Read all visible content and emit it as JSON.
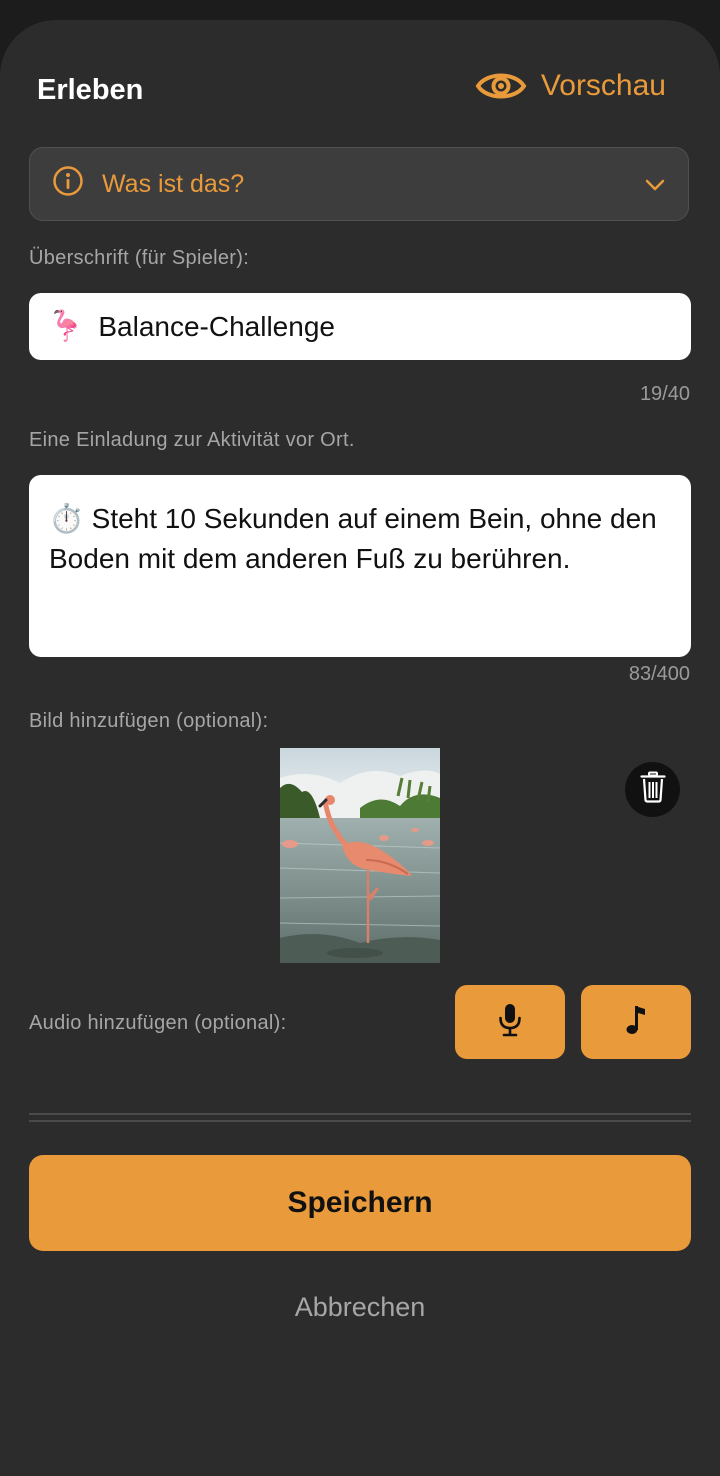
{
  "header": {
    "title": "Erleben",
    "preview_label": "Vorschau"
  },
  "info": {
    "label": "Was ist das?"
  },
  "heading_field": {
    "label": "Überschrift (für Spieler):",
    "emoji": "🦩",
    "value": "Balance-Challenge",
    "counter": "19/40"
  },
  "description_field": {
    "label": "Eine Einladung zur Aktivität vor Ort.",
    "value": "⏱️ Steht 10 Sekunden auf einem Bein, ohne den Boden mit dem anderen Fuß zu berühren.",
    "counter": "83/400"
  },
  "image_field": {
    "label": "Bild hinzufügen (optional):"
  },
  "audio_field": {
    "label": "Audio hinzufügen (optional):"
  },
  "actions": {
    "save_label": "Speichern",
    "cancel_label": "Abbrechen"
  },
  "colors": {
    "accent": "#e99a3b",
    "background": "#2c2c2c",
    "input_bg": "#ffffff"
  },
  "icons": {
    "preview": "eye-icon",
    "info": "info-circle-icon",
    "expand": "chevron-down-icon",
    "delete": "trash-icon",
    "record": "microphone-icon",
    "music": "music-note-icon"
  }
}
